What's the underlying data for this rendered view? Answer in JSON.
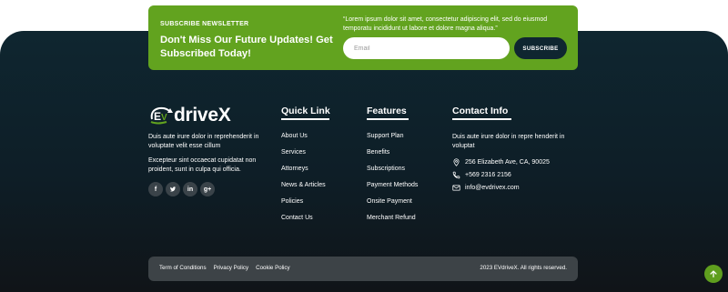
{
  "colors": {
    "accent_green": "#62a31f",
    "footer_dark": "#0f2630",
    "bottom_bar": "#3d4347"
  },
  "newsletter": {
    "kicker": "SUBSCRIBE NEWSLETTER",
    "heading": "Don't Miss Our Future Updates! Get Subscribed Today!",
    "quote": "“Lorem ipsum dolor sit amet, consectetur adipiscing elit, sed do eiusmod temporatu incididunt ut labore et dolore magna aliqua.”",
    "email_placeholder": "Email",
    "button_label": "SUBSCRIBE"
  },
  "brand": {
    "logo_text": "EVdriveX",
    "logo_icon": "plug-icon",
    "about_line1": "Duis aute irure dolor in reprehenderit in voluptate velit esse cillum",
    "about_line2": "Excepteur sint occaecat cupidatat non proident, sunt in culpa qui officia.",
    "socials": [
      {
        "icon": "facebook-icon",
        "glyph": "f"
      },
      {
        "icon": "twitter-icon",
        "glyph": "t"
      },
      {
        "icon": "linkedin-icon",
        "glyph": "in"
      },
      {
        "icon": "google-plus-icon",
        "glyph": "g+"
      }
    ]
  },
  "quick_link": {
    "title": "Quick Link",
    "items": [
      "About Us",
      "Services",
      "Attorneys",
      "News & Articles",
      "Policies",
      "Contact Us"
    ]
  },
  "features": {
    "title": "Features",
    "items": [
      "Support Plan",
      "Benefits",
      "Subscriptions",
      "Payment Methods",
      "Onsite Payment",
      "Merchant Refund"
    ]
  },
  "contact": {
    "title": "Contact Info",
    "description": "Duis aute irure dolor in repre henderit in voluptat",
    "address": "256 Elizabeth Ave, CA, 90025",
    "address_icon": "location-pin-icon",
    "phone": "+569 2316 2156",
    "phone_icon": "phone-icon",
    "email": "info@evdrivex.com",
    "email_icon": "envelope-icon"
  },
  "bottom": {
    "links": [
      "Term of Conditions",
      "Privacy Policy",
      "Cookie Policy"
    ],
    "copyright": "2023 EVdriveX. All rights reserved."
  },
  "back_to_top_icon": "arrow-up-icon"
}
